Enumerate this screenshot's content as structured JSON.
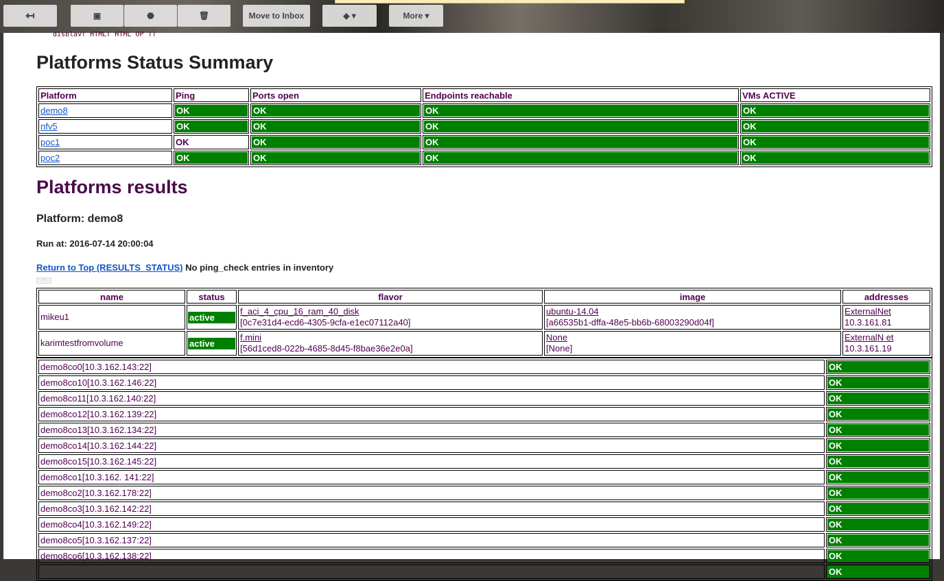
{
  "toolbar": {
    "move_to_inbox": "Move to Inbox",
    "more": "More"
  },
  "code_snippet": "display( HTML( HTML_OP ))",
  "summary": {
    "title": "Platforms Status Summary",
    "headers": [
      "Platform",
      "Ping",
      "Ports open",
      "Endpoints reachable",
      "VMs ACTIVE"
    ],
    "rows": [
      {
        "platform": "demo8",
        "ping": "OK",
        "ping_ok": true,
        "ports": "OK",
        "endpoints": "OK",
        "vms": "OK"
      },
      {
        "platform": "nfv5",
        "ping": "OK",
        "ping_ok": true,
        "ports": "OK",
        "endpoints": "OK",
        "vms": "OK"
      },
      {
        "platform": "poc1",
        "ping": "OK",
        "ping_ok": false,
        "ports": "OK",
        "endpoints": "OK",
        "vms": "OK"
      },
      {
        "platform": "poc2",
        "ping": "OK",
        "ping_ok": true,
        "ports": "OK",
        "endpoints": "OK",
        "vms": "OK"
      }
    ]
  },
  "results": {
    "title": "Platforms results",
    "platform": "Platform: demo8",
    "run_at": "Run at: 2016-07-14 20:00:04",
    "return_link": "Return to Top (RESULTS_STATUS)",
    "ping_note": "No ping_check entries in inventory",
    "ellipsis": "···"
  },
  "vms": {
    "headers": [
      "name",
      "status",
      "flavor",
      "image",
      "addresses"
    ],
    "rows": [
      {
        "name": "mikeu1",
        "status": "active",
        "flavor": "f_aci_4_cpu_16_ram_40_disk",
        "flavor_id": "[0c7e31d4-ecd6-4305-9cfa-e1ec07112a40]",
        "image": "ubuntu-14.04",
        "image_id": "[a66535b1-dffa-48e5-bb6b-68003290d04f]",
        "net": "ExternalNet",
        "ip": "10.3.161.81"
      },
      {
        "name": "karimtestfromvolume",
        "status": "active",
        "flavor": "f.mini",
        "flavor_id": "[56d1ced8-022b-4685-8d45-f8bae36e2e0a]",
        "image": "None",
        "image_id": "[None]",
        "net": "ExternalN et",
        "ip": "10.3.161.19"
      }
    ]
  },
  "hosts": [
    {
      "name": "demo8co0[10.3.162.143:22]",
      "status": "OK"
    },
    {
      "name": "demo8co10[10.3.162.146:22]",
      "status": "OK"
    },
    {
      "name": "demo8co11[10.3.162.140:22]",
      "status": "OK"
    },
    {
      "name": "demo8co12[10.3.162.139:22]",
      "status": "OK"
    },
    {
      "name": "demo8co13[10.3.162.134:22]",
      "status": "OK"
    },
    {
      "name": "demo8co14[10.3.162.144:22]",
      "status": "OK"
    },
    {
      "name": "demo8co15[10.3.162.145:22]",
      "status": "OK"
    },
    {
      "name": "demo8co1[10.3.162. 141:22]",
      "status": "OK"
    },
    {
      "name": "demo8co2[10.3.162.178:22]",
      "status": "OK"
    },
    {
      "name": "demo8co3[10.3.162.142:22]",
      "status": "OK"
    },
    {
      "name": "demo8co4[10.3.162.149:22]",
      "status": "OK"
    },
    {
      "name": "demo8co5[10.3.162.137:22]",
      "status": "OK"
    },
    {
      "name": "demo8co6[10.3.162.138:22]",
      "status": "OK"
    },
    {
      "name": "",
      "status": "OK"
    }
  ],
  "colors": {
    "ok": "#008000",
    "link": "#1155cc",
    "text": "#500050"
  }
}
